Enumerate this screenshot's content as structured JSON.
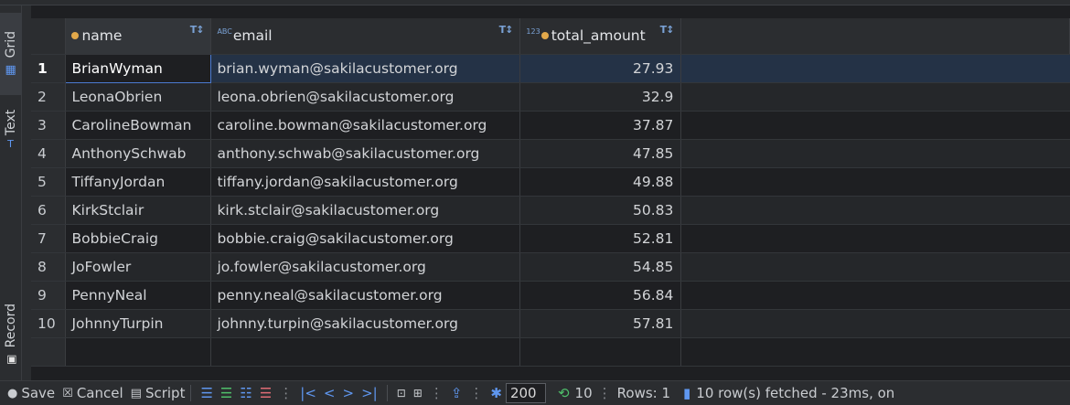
{
  "side_tabs": {
    "grid": "Grid",
    "text": "Text",
    "record": "Record"
  },
  "columns": [
    {
      "name": "name",
      "type_tag": "",
      "key": true
    },
    {
      "name": "email",
      "type_tag": "ABC",
      "key": false
    },
    {
      "name": "total_amount",
      "type_tag": "123",
      "key": true
    }
  ],
  "rows": [
    {
      "num": "1",
      "name": "BrianWyman",
      "email": "brian.wyman@sakilacustomer.org",
      "total_amount": "27.93"
    },
    {
      "num": "2",
      "name": "LeonaObrien",
      "email": "leona.obrien@sakilacustomer.org",
      "total_amount": "32.9"
    },
    {
      "num": "3",
      "name": "CarolineBowman",
      "email": "caroline.bowman@sakilacustomer.org",
      "total_amount": "37.87"
    },
    {
      "num": "4",
      "name": "AnthonySchwab",
      "email": "anthony.schwab@sakilacustomer.org",
      "total_amount": "47.85"
    },
    {
      "num": "5",
      "name": "TiffanyJordan",
      "email": "tiffany.jordan@sakilacustomer.org",
      "total_amount": "49.88"
    },
    {
      "num": "6",
      "name": "KirkStclair",
      "email": "kirk.stclair@sakilacustomer.org",
      "total_amount": "50.83"
    },
    {
      "num": "7",
      "name": "BobbieCraig",
      "email": "bobbie.craig@sakilacustomer.org",
      "total_amount": "52.81"
    },
    {
      "num": "8",
      "name": "JoFowler",
      "email": "jo.fowler@sakilacustomer.org",
      "total_amount": "54.85"
    },
    {
      "num": "9",
      "name": "PennyNeal",
      "email": "penny.neal@sakilacustomer.org",
      "total_amount": "56.84"
    },
    {
      "num": "10",
      "name": "JohnnyTurpin",
      "email": "johnny.turpin@sakilacustomer.org",
      "total_amount": "57.81"
    }
  ],
  "toolbar": {
    "save": "Save",
    "cancel": "Cancel",
    "script": "Script",
    "fetch_size": "200",
    "row_count": "10",
    "rows_label": "Rows: 1",
    "status": "10 row(s) fetched - 23ms, on"
  },
  "colors": {
    "selected_cell": "#214283",
    "accent": "#5f97f0",
    "key_dot": "#e2a84a"
  }
}
